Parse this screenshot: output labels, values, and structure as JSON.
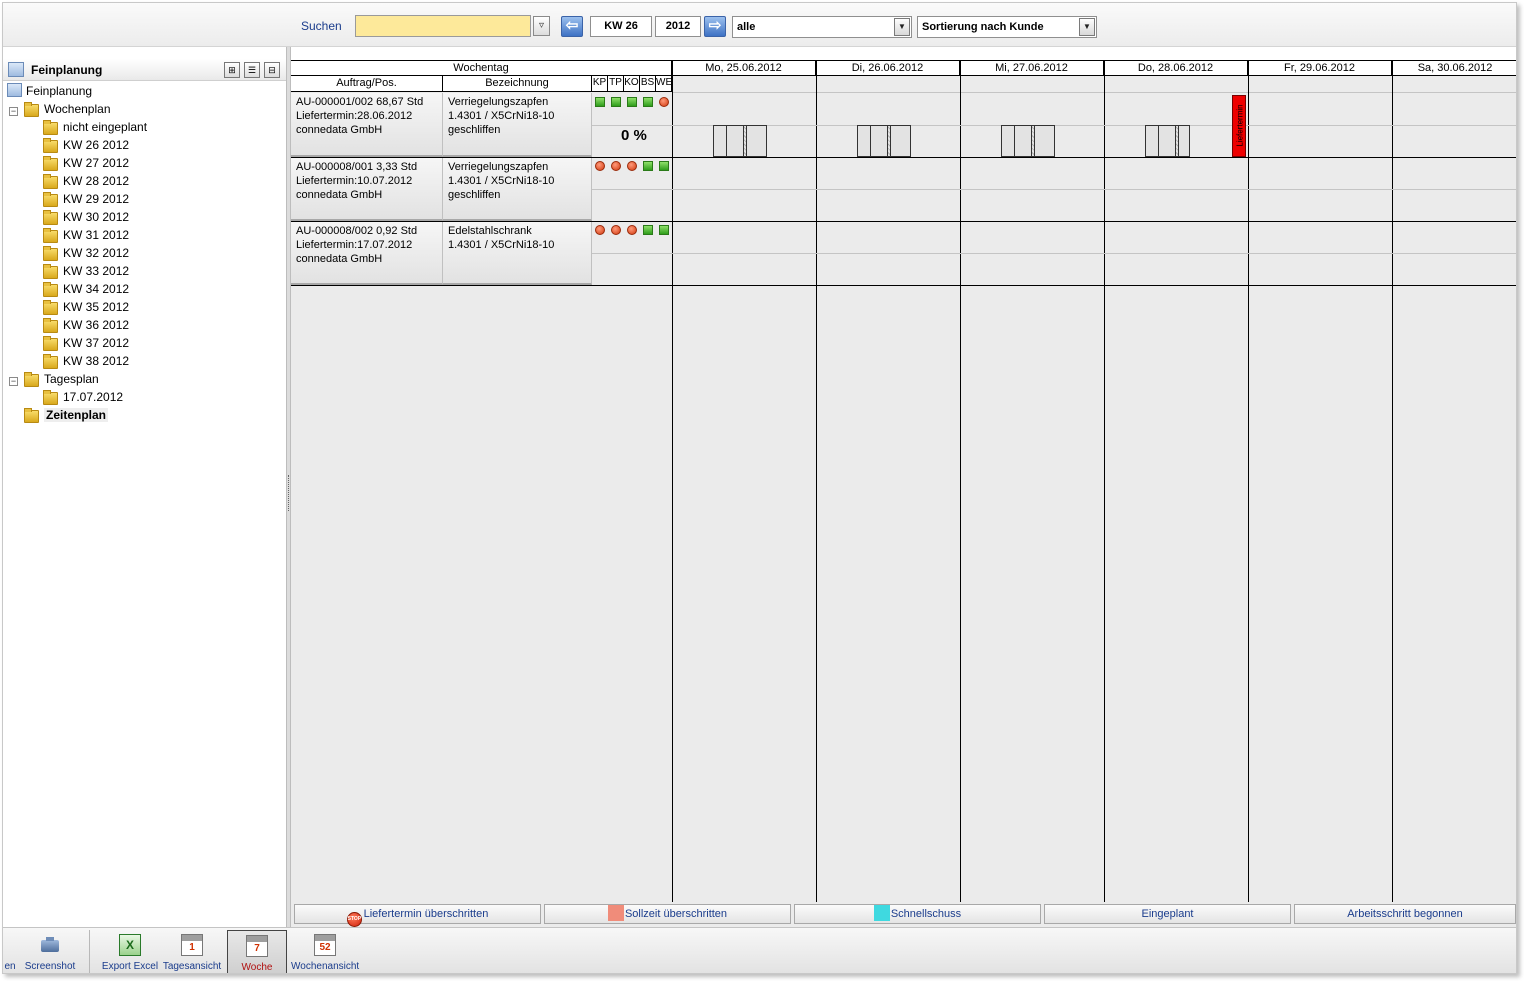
{
  "toolbar": {
    "search_label": "Suchen",
    "search_value": "",
    "week": "KW 26",
    "year": "2012",
    "filter": "alle",
    "sort": "Sortierung nach Kunde"
  },
  "tree": {
    "header_title": "Feinplanung",
    "root": "Feinplanung",
    "wochenplan": "Wochenplan",
    "weeks": [
      "nicht eingeplant",
      "KW 26 2012",
      "KW 27 2012",
      "KW 28 2012",
      "KW 29 2012",
      "KW 30 2012",
      "KW 31 2012",
      "KW 32 2012",
      "KW 33 2012",
      "KW 34 2012",
      "KW 35 2012",
      "KW 36 2012",
      "KW 37 2012",
      "KW 38 2012"
    ],
    "tagesplan": "Tagesplan",
    "days": [
      "17.07.2012"
    ],
    "zeitenplan": "Zeitenplan"
  },
  "grid": {
    "weekday_header": "Wochentag",
    "col_order": "Auftrag/Pos.",
    "col_desc": "Bezeichnung",
    "status_cols": [
      "KP",
      "TP",
      "KO",
      "BS",
      "WE"
    ],
    "days": [
      "Mo, 25.06.2012",
      "Di, 26.06.2012",
      "Mi, 27.06.2012",
      "Do, 28.06.2012",
      "Fr, 29.06.2012",
      "Sa, 30.06.2012"
    ],
    "rows": [
      {
        "order": "AU-000001/002 68,67 Std",
        "deadline": "Liefertermin:28.06.2012",
        "customer": "connedata GmbH",
        "desc1": "Verriegelungszapfen",
        "desc2": "1.4301 / X5CrNi18-10",
        "desc3": "geschliffen",
        "status": [
          "green",
          "green",
          "green",
          "green",
          "red"
        ],
        "progress": "0 %"
      },
      {
        "order": "AU-000008/001 3,33 Std",
        "deadline": "Liefertermin:10.07.2012",
        "customer": "connedata GmbH",
        "desc1": "Verriegelungszapfen",
        "desc2": "1.4301 / X5CrNi18-10",
        "desc3": "geschliffen",
        "status": [
          "red",
          "red",
          "red",
          "green",
          "green"
        ]
      },
      {
        "order": "AU-000008/002 0,92 Std",
        "deadline": "Liefertermin:17.07.2012",
        "customer": "connedata GmbH",
        "desc1": "Edelstahlschrank",
        "desc2": "1.4301 / X5CrNi18-10",
        "desc3": "",
        "status": [
          "red",
          "red",
          "red",
          "green",
          "green"
        ]
      }
    ],
    "deadline_marker": "Liefertermin"
  },
  "legend": {
    "overdue": "Liefertermin überschritten",
    "target_exceeded": "Sollzeit überschritten",
    "rush": "Schnellschuss",
    "planned": "Eingeplant",
    "started": "Arbeitsschritt begonnen",
    "colors": {
      "target_exceeded": "#f08c7a",
      "rush": "#3fd9e0",
      "deadline": "#ee0000"
    }
  },
  "taskbar": {
    "partial": "en",
    "screenshot": "Screenshot",
    "export_excel": "Export Excel",
    "tagesansicht": "Tagesansicht",
    "tagesansicht_num": "1",
    "woche": "Woche",
    "woche_num": "7",
    "wochenansicht": "Wochenansicht",
    "wochenansicht_num": "52"
  }
}
